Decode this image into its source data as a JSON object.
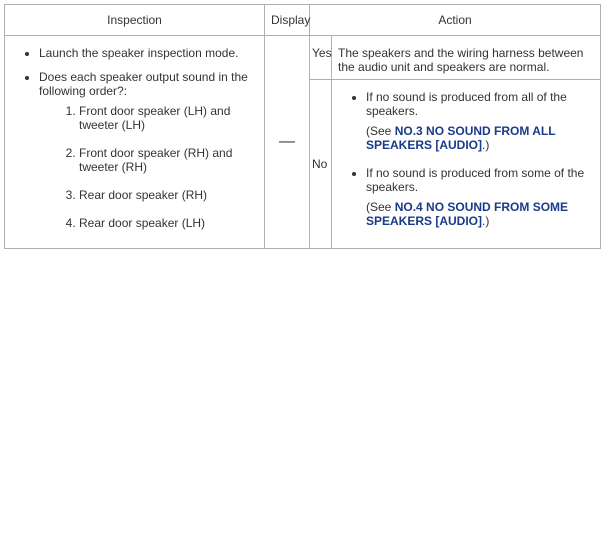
{
  "headers": {
    "inspection": "Inspection",
    "display": "Display",
    "action": "Action"
  },
  "inspection": {
    "bullet1": "Launch the speaker inspection mode.",
    "bullet2": "Does each speaker output sound in the following order?:",
    "order": {
      "i1": "Front door speaker (LH) and tweeter (LH)",
      "i2": "Front door speaker (RH) and tweeter (RH)",
      "i3": "Rear door speaker (RH)",
      "i4": "Rear door speaker (LH)"
    }
  },
  "display_value": "—",
  "results": {
    "yes": "Yes",
    "no": "No"
  },
  "action_yes": "The speakers and the wiring harness between the audio unit and speakers are normal.",
  "action_no": {
    "item1_text": "If no sound is produced from all of the speakers.",
    "item1_see_prefix": "(See ",
    "item1_link": "NO.3 NO SOUND FROM ALL SPEAKERS [AUDIO]",
    "item1_see_suffix": ".)",
    "item2_text": "If no sound is produced from some of the speakers.",
    "item2_see_prefix": "(See ",
    "item2_link": "NO.4 NO SOUND FROM SOME SPEAKERS [AUDIO]",
    "item2_see_suffix": ".)"
  }
}
